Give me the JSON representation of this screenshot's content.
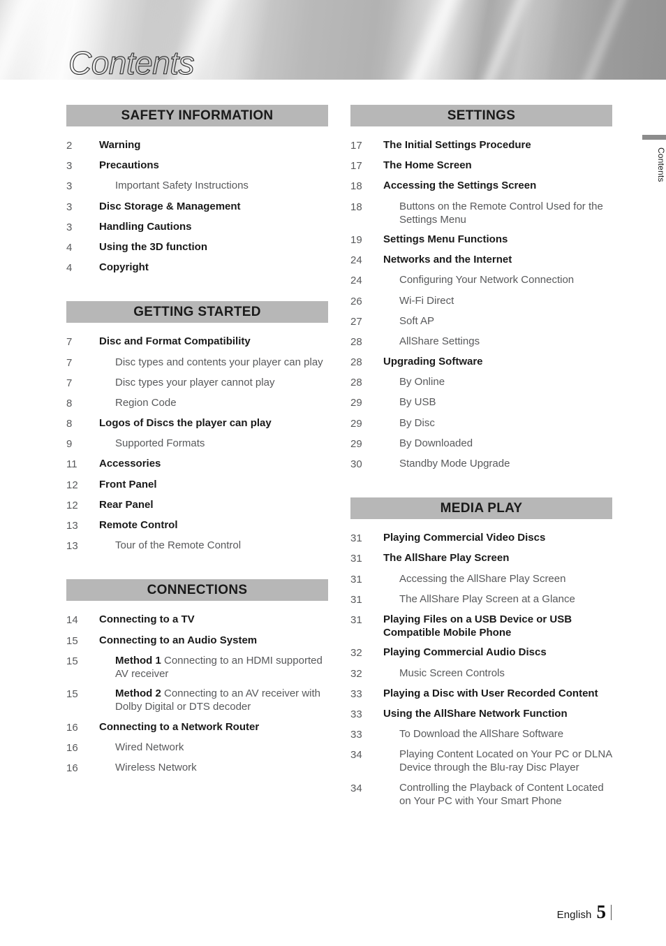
{
  "header": {
    "title": "Contents"
  },
  "side_tab": {
    "label": "Contents"
  },
  "footer": {
    "language": "English",
    "page_number": "5"
  },
  "colors": {
    "section_bar": "#b7b7b7",
    "level1_text": "#1a1a1a",
    "level2_text": "#58595b",
    "side_tab_bar": "#8c8c8c"
  },
  "columns": [
    {
      "id": "left",
      "sections": [
        {
          "title": "SAFETY INFORMATION",
          "entries": [
            {
              "page": "2",
              "text": "Warning",
              "level": 1
            },
            {
              "page": "3",
              "text": "Precautions",
              "level": 1
            },
            {
              "page": "3",
              "text": "Important Safety Instructions",
              "level": 2
            },
            {
              "page": "3",
              "text": "Disc Storage & Management",
              "level": 1
            },
            {
              "page": "3",
              "text": "Handling Cautions",
              "level": 1
            },
            {
              "page": "4",
              "text": "Using the 3D function",
              "level": 1
            },
            {
              "page": "4",
              "text": "Copyright",
              "level": 1
            }
          ]
        },
        {
          "title": "GETTING STARTED",
          "entries": [
            {
              "page": "7",
              "text": "Disc and Format Compatibility",
              "level": 1
            },
            {
              "page": "7",
              "text": "Disc types and contents your player can play",
              "level": 2
            },
            {
              "page": "7",
              "text": "Disc types your player cannot play",
              "level": 2
            },
            {
              "page": "8",
              "text": "Region Code",
              "level": 2
            },
            {
              "page": "8",
              "text": "Logos of Discs the player can play",
              "level": 1
            },
            {
              "page": "9",
              "text": "Supported Formats",
              "level": 2
            },
            {
              "page": "11",
              "text": "Accessories",
              "level": 1
            },
            {
              "page": "12",
              "text": "Front Panel",
              "level": 1
            },
            {
              "page": "12",
              "text": "Rear Panel",
              "level": 1
            },
            {
              "page": "13",
              "text": "Remote Control",
              "level": 1
            },
            {
              "page": "13",
              "text": "Tour of the Remote Control",
              "level": 2
            }
          ]
        },
        {
          "title": "CONNECTIONS",
          "entries": [
            {
              "page": "14",
              "text": "Connecting to a TV",
              "level": 1
            },
            {
              "page": "15",
              "text": "Connecting to an Audio System",
              "level": 1
            },
            {
              "page": "15",
              "lead": "Method 1",
              "text": " Connecting to an HDMI supported AV receiver",
              "level": 2
            },
            {
              "page": "15",
              "lead": "Method 2",
              "text": " Connecting to an AV receiver with Dolby Digital or DTS decoder",
              "level": 2
            },
            {
              "page": "16",
              "text": "Connecting to a Network Router",
              "level": 1
            },
            {
              "page": "16",
              "text": "Wired Network",
              "level": 2
            },
            {
              "page": "16",
              "text": "Wireless Network",
              "level": 2
            }
          ]
        }
      ]
    },
    {
      "id": "right",
      "sections": [
        {
          "title": "SETTINGS",
          "entries": [
            {
              "page": "17",
              "text": "The Initial Settings Procedure",
              "level": 1
            },
            {
              "page": "17",
              "text": "The Home Screen",
              "level": 1
            },
            {
              "page": "18",
              "text": "Accessing the Settings Screen",
              "level": 1
            },
            {
              "page": "18",
              "text": "Buttons on the Remote Control Used for the Settings Menu",
              "level": 2
            },
            {
              "page": "19",
              "text": "Settings Menu Functions",
              "level": 1
            },
            {
              "page": "24",
              "text": "Networks and the Internet",
              "level": 1
            },
            {
              "page": "24",
              "text": "Configuring Your Network Connection",
              "level": 2
            },
            {
              "page": "26",
              "text": "Wi-Fi Direct",
              "level": 2
            },
            {
              "page": "27",
              "text": "Soft AP",
              "level": 2
            },
            {
              "page": "28",
              "text": "AllShare Settings",
              "level": 2
            },
            {
              "page": "28",
              "text": "Upgrading Software",
              "level": 1
            },
            {
              "page": "28",
              "text": "By Online",
              "level": 2
            },
            {
              "page": "29",
              "text": "By USB",
              "level": 2
            },
            {
              "page": "29",
              "text": "By Disc",
              "level": 2
            },
            {
              "page": "29",
              "text": "By Downloaded",
              "level": 2
            },
            {
              "page": "30",
              "text": "Standby Mode Upgrade",
              "level": 2
            }
          ]
        },
        {
          "title": "MEDIA PLAY",
          "entries": [
            {
              "page": "31",
              "text": "Playing Commercial Video Discs",
              "level": 1
            },
            {
              "page": "31",
              "text": "The AllShare Play Screen",
              "level": 1
            },
            {
              "page": "31",
              "text": "Accessing the AllShare Play Screen",
              "level": 2
            },
            {
              "page": "31",
              "text": "The AllShare Play Screen at a Glance",
              "level": 2
            },
            {
              "page": "31",
              "text": "Playing Files on a USB Device or USB Compatible Mobile Phone",
              "level": 1
            },
            {
              "page": "32",
              "text": "Playing Commercial Audio Discs",
              "level": 1
            },
            {
              "page": "32",
              "text": "Music Screen Controls",
              "level": 2
            },
            {
              "page": "33",
              "text": "Playing a Disc with User Recorded Content",
              "level": 1
            },
            {
              "page": "33",
              "text": "Using the AllShare Network Function",
              "level": 1
            },
            {
              "page": "33",
              "text": "To Download the AllShare Software",
              "level": 2
            },
            {
              "page": "34",
              "text": "Playing Content Located on Your PC or DLNA Device through the Blu-ray Disc Player",
              "level": 2
            },
            {
              "page": "34",
              "text": "Controlling the Playback of Content Located on Your PC with Your Smart Phone",
              "level": 2
            }
          ]
        }
      ]
    }
  ]
}
